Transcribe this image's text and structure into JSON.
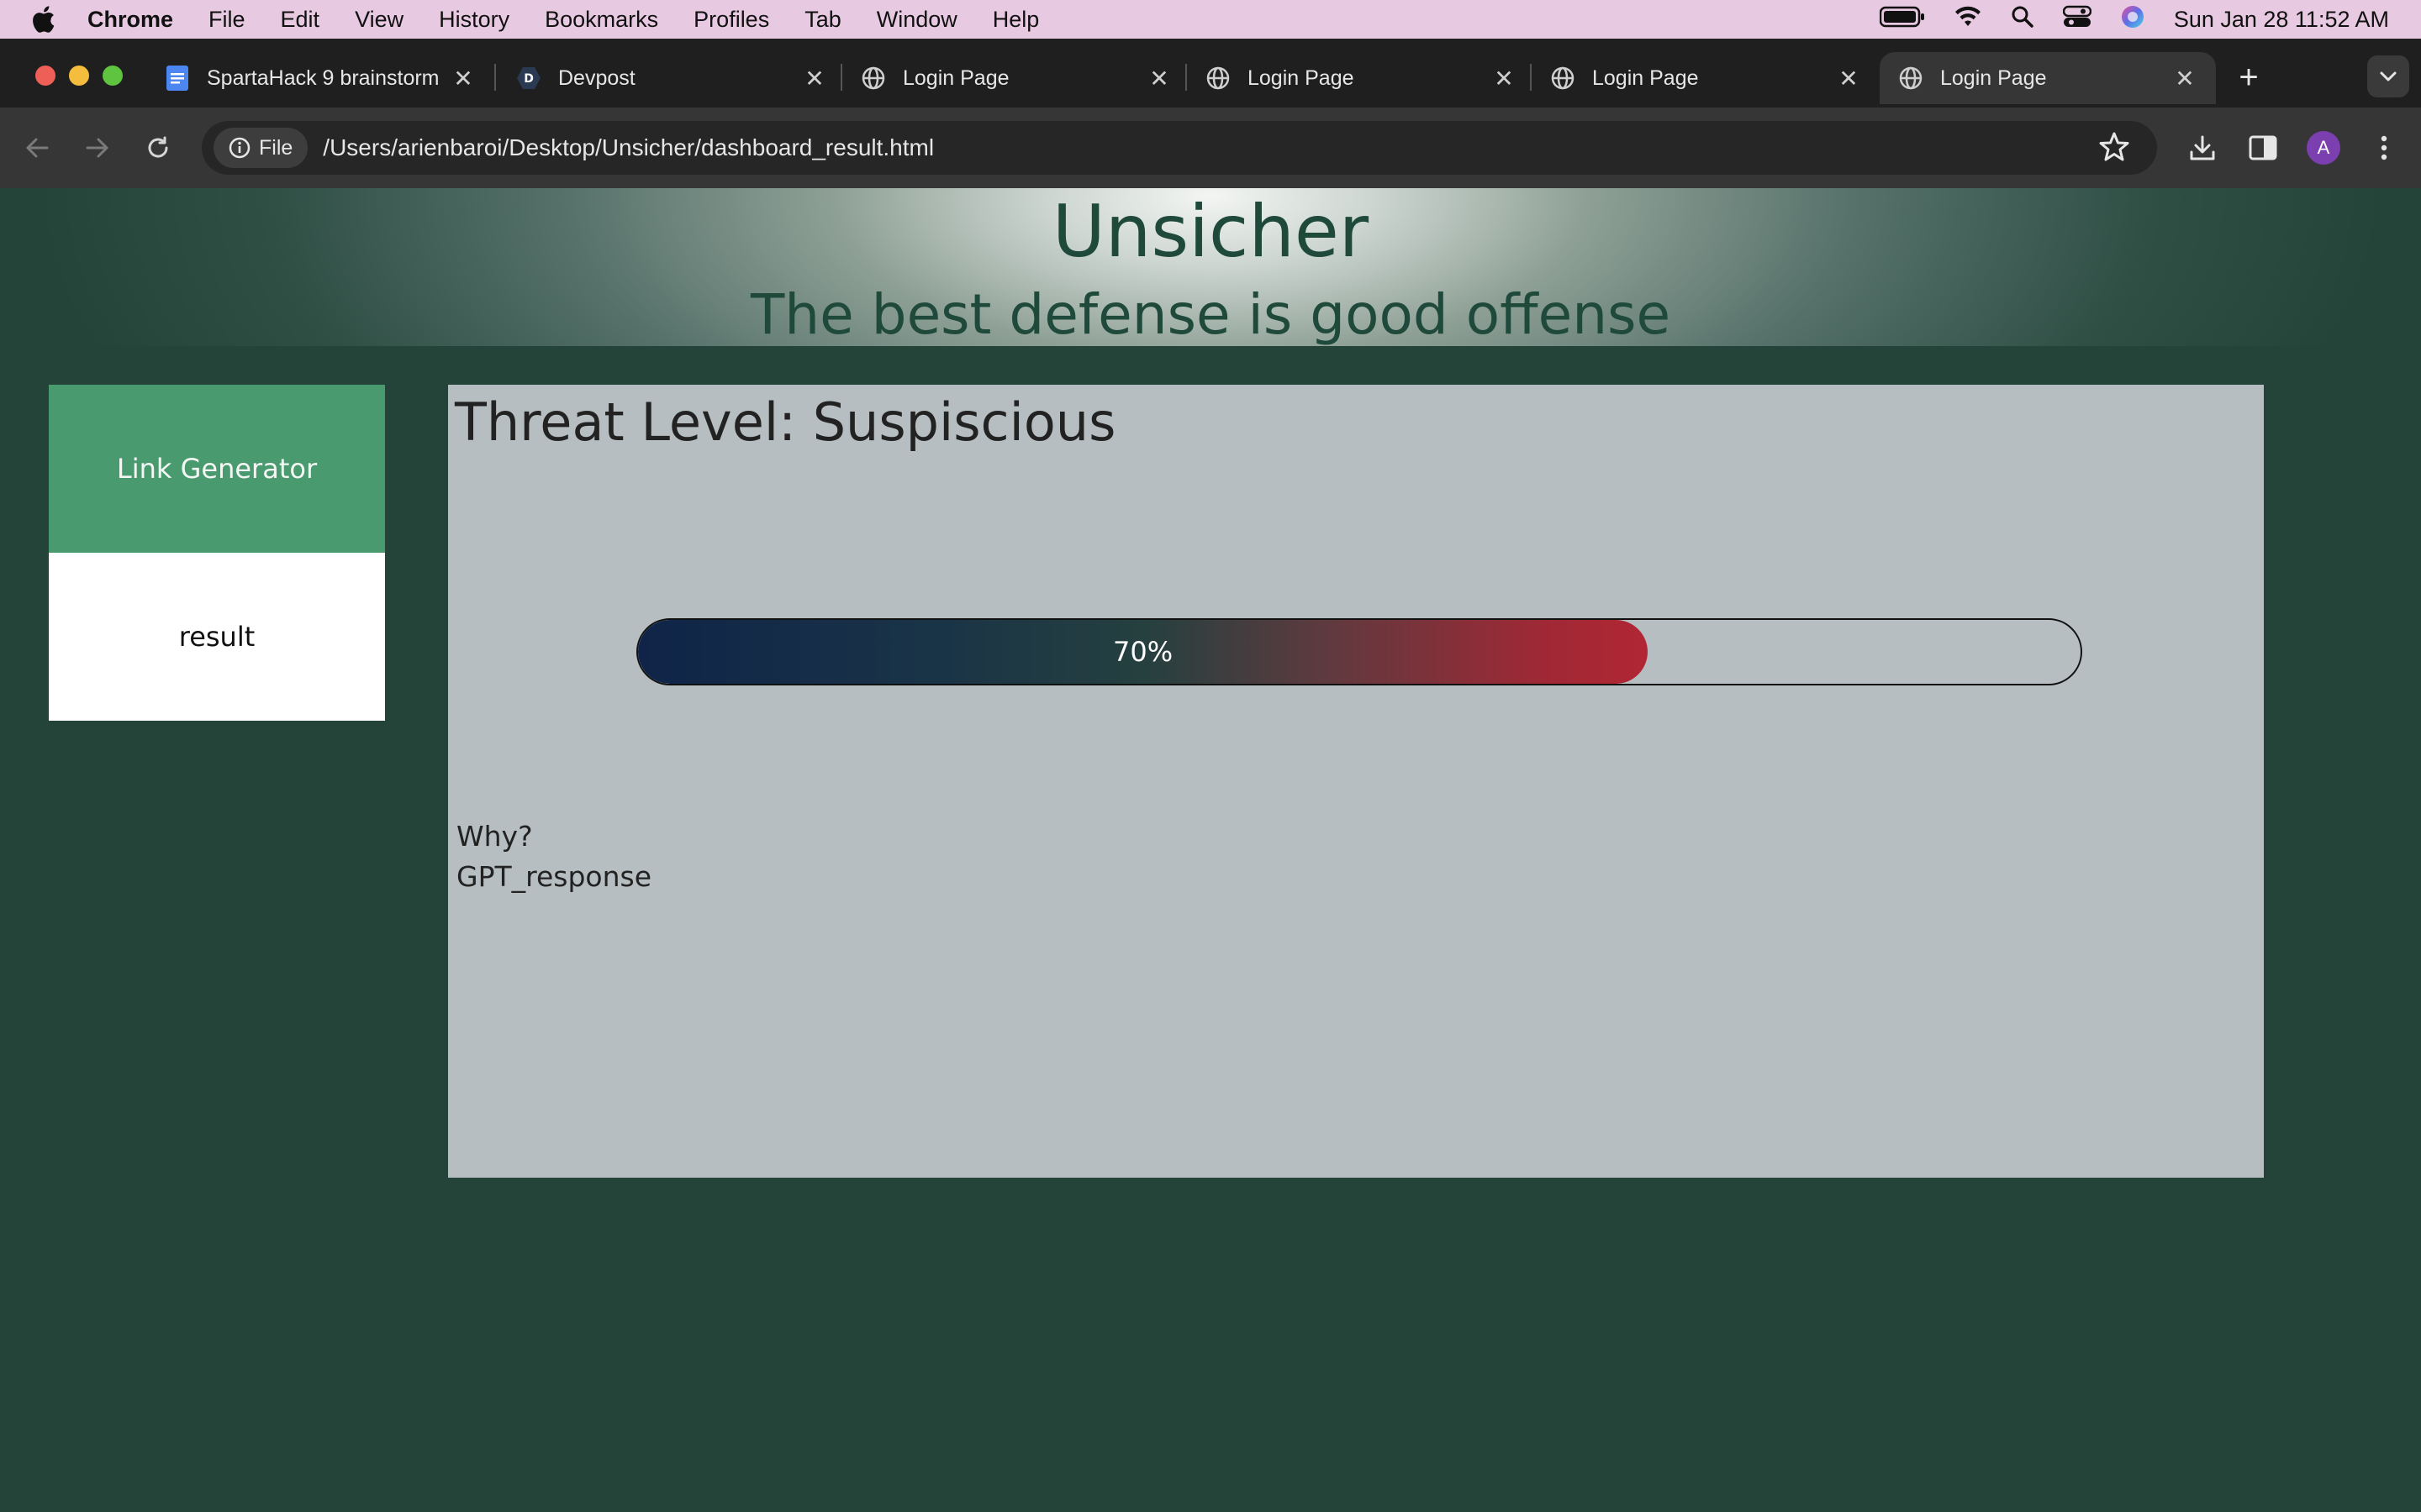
{
  "menubar": {
    "app_name": "Chrome",
    "menus": [
      "File",
      "Edit",
      "View",
      "History",
      "Bookmarks",
      "Profiles",
      "Tab",
      "Window",
      "Help"
    ],
    "clock": "Sun Jan 28  11:52 AM"
  },
  "tabs": [
    {
      "title": "SpartaHack 9 brainstorm",
      "icon": "google-docs-icon"
    },
    {
      "title": "Devpost",
      "icon": "devpost-icon"
    },
    {
      "title": "Login Page",
      "icon": "globe-icon"
    },
    {
      "title": "Login Page",
      "icon": "globe-icon"
    },
    {
      "title": "Login Page",
      "icon": "globe-icon"
    },
    {
      "title": "Login Page",
      "icon": "globe-icon",
      "active": true
    }
  ],
  "toolbar": {
    "chip_label": "File",
    "url": "/Users/arienbaroi/Desktop/Unsicher/dashboard_result.html",
    "avatar_letter": "A"
  },
  "site": {
    "title": "Unsicher",
    "tagline": "The best defense is good offense"
  },
  "sidebar": {
    "items": [
      {
        "label": "Link Generator"
      },
      {
        "label": "result"
      }
    ]
  },
  "result": {
    "threat_level": "Threat Level: Suspiscious",
    "progress_value": 0.7,
    "progress_label": "70%",
    "why_label": "Why?",
    "gpt_response": "GPT_response"
  },
  "colors": {
    "page_bg": "#244339",
    "accent_green": "#4a9a70",
    "panel_bg": "#b6bec1",
    "progress_start": "#0f2448",
    "progress_end": "#b12634",
    "title_color": "#1f4a3b"
  }
}
